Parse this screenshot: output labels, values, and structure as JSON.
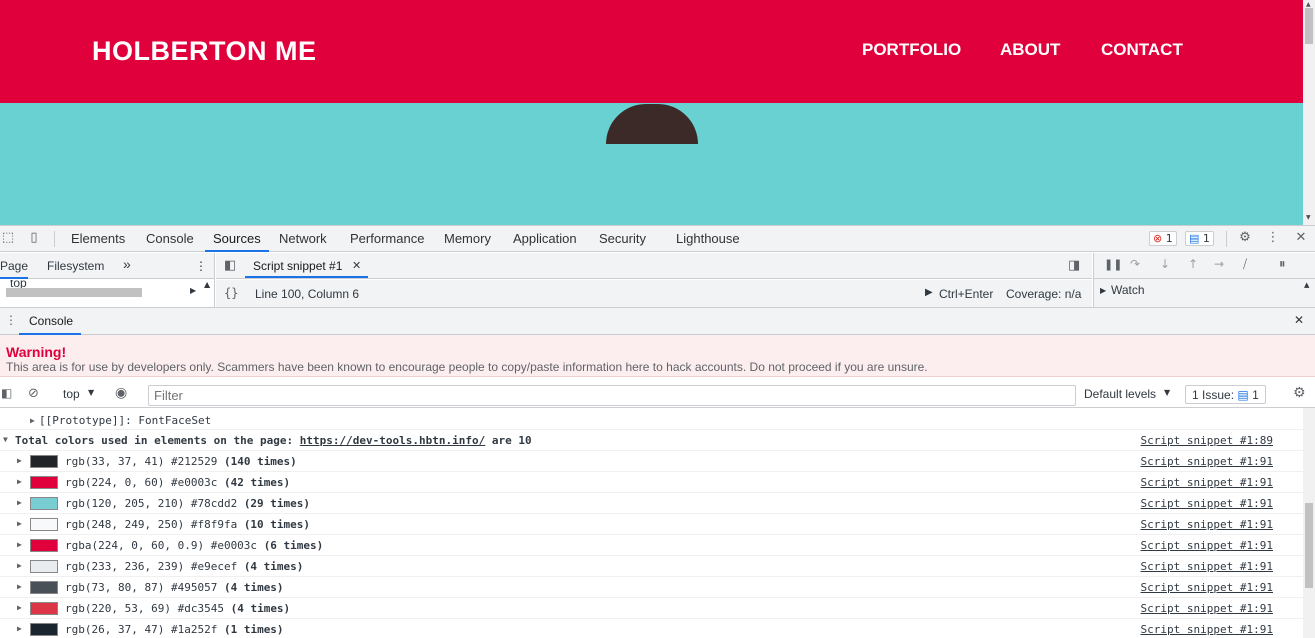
{
  "site": {
    "logo": "HOLBERTON ME",
    "nav": [
      "PORTFOLIO",
      "ABOUT",
      "CONTACT"
    ],
    "colors": {
      "header": "#e0003c",
      "hero": "#6ad1d3"
    }
  },
  "devtools": {
    "tabs": [
      "Elements",
      "Console",
      "Sources",
      "Network",
      "Performance",
      "Memory",
      "Application",
      "Security",
      "Lighthouse"
    ],
    "active_tab": "Sources",
    "error_count": "1",
    "message_count": "1",
    "nav_tabs": {
      "page": "Page",
      "filesystem": "Filesystem",
      "more": "»"
    },
    "tree_item": "top",
    "editor_tab": "Script snippet #1",
    "cursor_pos": "Line 100, Column 6",
    "run_shortcut": "Ctrl+Enter",
    "coverage": "Coverage: n/a",
    "watch": "Watch",
    "drawer_tab": "Console",
    "warning_title": "Warning!",
    "warning_body": "This area is for use by developers only. Scammers have been known to encourage people to copy/paste information here to hack accounts. Do not proceed if you are unsure.",
    "context": "top",
    "filter_placeholder": "Filter",
    "levels": "Default levels",
    "issues": "1 Issue:",
    "issues_count": "1"
  },
  "console": {
    "prototype_line": "[[Prototype]]: FontFaceSet",
    "summary": {
      "text": "Total colors used in elements on the page:",
      "url": "https://dev-tools.hbtn.info/",
      "suffix": "are 10",
      "source": "Script snippet #1:89"
    },
    "colors": [
      {
        "swatch": "#212529",
        "value": "rgb(33, 37, 41) #212529",
        "times": "(140 times)",
        "source": "Script snippet #1:91"
      },
      {
        "swatch": "#e0003c",
        "value": "rgb(224, 0, 60) #e0003c",
        "times": "(42 times)",
        "source": "Script snippet #1:91"
      },
      {
        "swatch": "#78cdd2",
        "value": "rgb(120, 205, 210) #78cdd2",
        "times": "(29 times)",
        "source": "Script snippet #1:91"
      },
      {
        "swatch": "#f8f9fa",
        "value": "rgb(248, 249, 250) #f8f9fa",
        "times": "(10 times)",
        "source": "Script snippet #1:91"
      },
      {
        "swatch": "#e0003c",
        "value": "rgba(224, 0, 60, 0.9) #e0003c",
        "times": "(6 times)",
        "source": "Script snippet #1:91"
      },
      {
        "swatch": "#e9ecef",
        "value": "rgb(233, 236, 239) #e9ecef",
        "times": "(4 times)",
        "source": "Script snippet #1:91"
      },
      {
        "swatch": "#495057",
        "value": "rgb(73, 80, 87) #495057",
        "times": "(4 times)",
        "source": "Script snippet #1:91"
      },
      {
        "swatch": "#dc3545",
        "value": "rgb(220, 53, 69) #dc3545",
        "times": "(4 times)",
        "source": "Script snippet #1:91"
      },
      {
        "swatch": "#1a252f",
        "value": "rgb(26, 37, 47) #1a252f",
        "times": "(1 times)",
        "source": "Script snippet #1:91"
      }
    ]
  }
}
